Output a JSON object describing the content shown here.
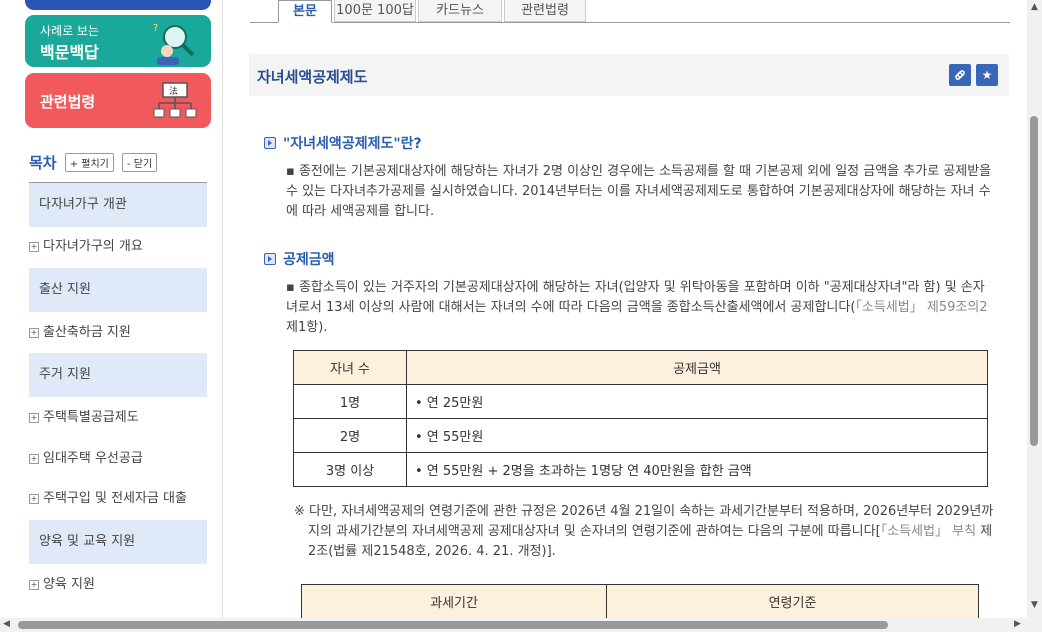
{
  "sidebar": {
    "banner_qa_small": "사례로 보는",
    "banner_qa_big": "백문백답",
    "banner_law": "관련법령",
    "banner_law_icon_text": "法",
    "toc_title": "목차",
    "expand_label": "+ 펼치기",
    "collapse_label": "- 닫기",
    "sections": [
      "다자녀가구 개관",
      "출산 지원",
      "주거 지원",
      "양육 및 교육 지원"
    ],
    "items": [
      "다자녀가구의 개요",
      "출산축하금 지원",
      "주택특별공급제도",
      "임대주택 우선공급",
      "주택구입 및 전세자금 대출",
      "양육 지원"
    ]
  },
  "tabs": [
    "본문",
    "100문 100답",
    "카드뉴스",
    "관련법령"
  ],
  "page_title": "자녀세액공제제도",
  "section1": {
    "heading": "\"자녀세액공제제도\"란?",
    "text": "종전에는 기본공제대상자에 해당하는 자녀가 2명 이상인 경우에는 소득공제를 할 때 기본공제 외에 일정 금액을 추가로 공제받을 수 있는 다자녀추가공제를 실시하였습니다. 2014년부터는 이를 자녀세액공제제도로 통합하여 기본공제대상자에 해당하는 자녀 수에 따라 세액공제를 합니다."
  },
  "section2": {
    "heading": "공제금액",
    "text_a": "종합소득이 있는 거주자의 기본공제대상자에 해당하는 자녀(입양자 및 위탁아동을 포함하며 이하 \"공제대상자녀\"라 함) 및 손자녀로서 13세 이상의 사람에 대해서는 자녀의 수에 따라 다음의 금액을 종합소득산출세액에서 공제합니다(",
    "text_link": "「소득세법」 제59조의2",
    "text_b": "제1항)."
  },
  "table1": {
    "headers": [
      "자녀 수",
      "공제금액"
    ],
    "rows": [
      [
        "1명",
        "• 연 25만원"
      ],
      [
        "2명",
        "• 연 55만원"
      ],
      [
        "3명 이상",
        "• 연 55만원 + 2명을 초과하는 1명당 연 40만원을 합한 금액"
      ]
    ]
  },
  "note": {
    "text_a": "※ 다만, 자녀세액공제의 연령기준에 관한 규정은 2026년 4월 21일이 속하는 과세기간분부터 적용하며, 2026년부터 2029년까지의 과세기간분의 자녀세액공제 공제대상자녀 및 손자녀의 연령기준에 관하여는 다음의 구분에 따릅니다[",
    "text_link": "「소득세법」 부칙",
    "text_b": "제2조(법률 제21548호, 2026. 4. 21. 개정)]."
  },
  "table2": {
    "headers": [
      "과세기간",
      "연령기준"
    ]
  }
}
